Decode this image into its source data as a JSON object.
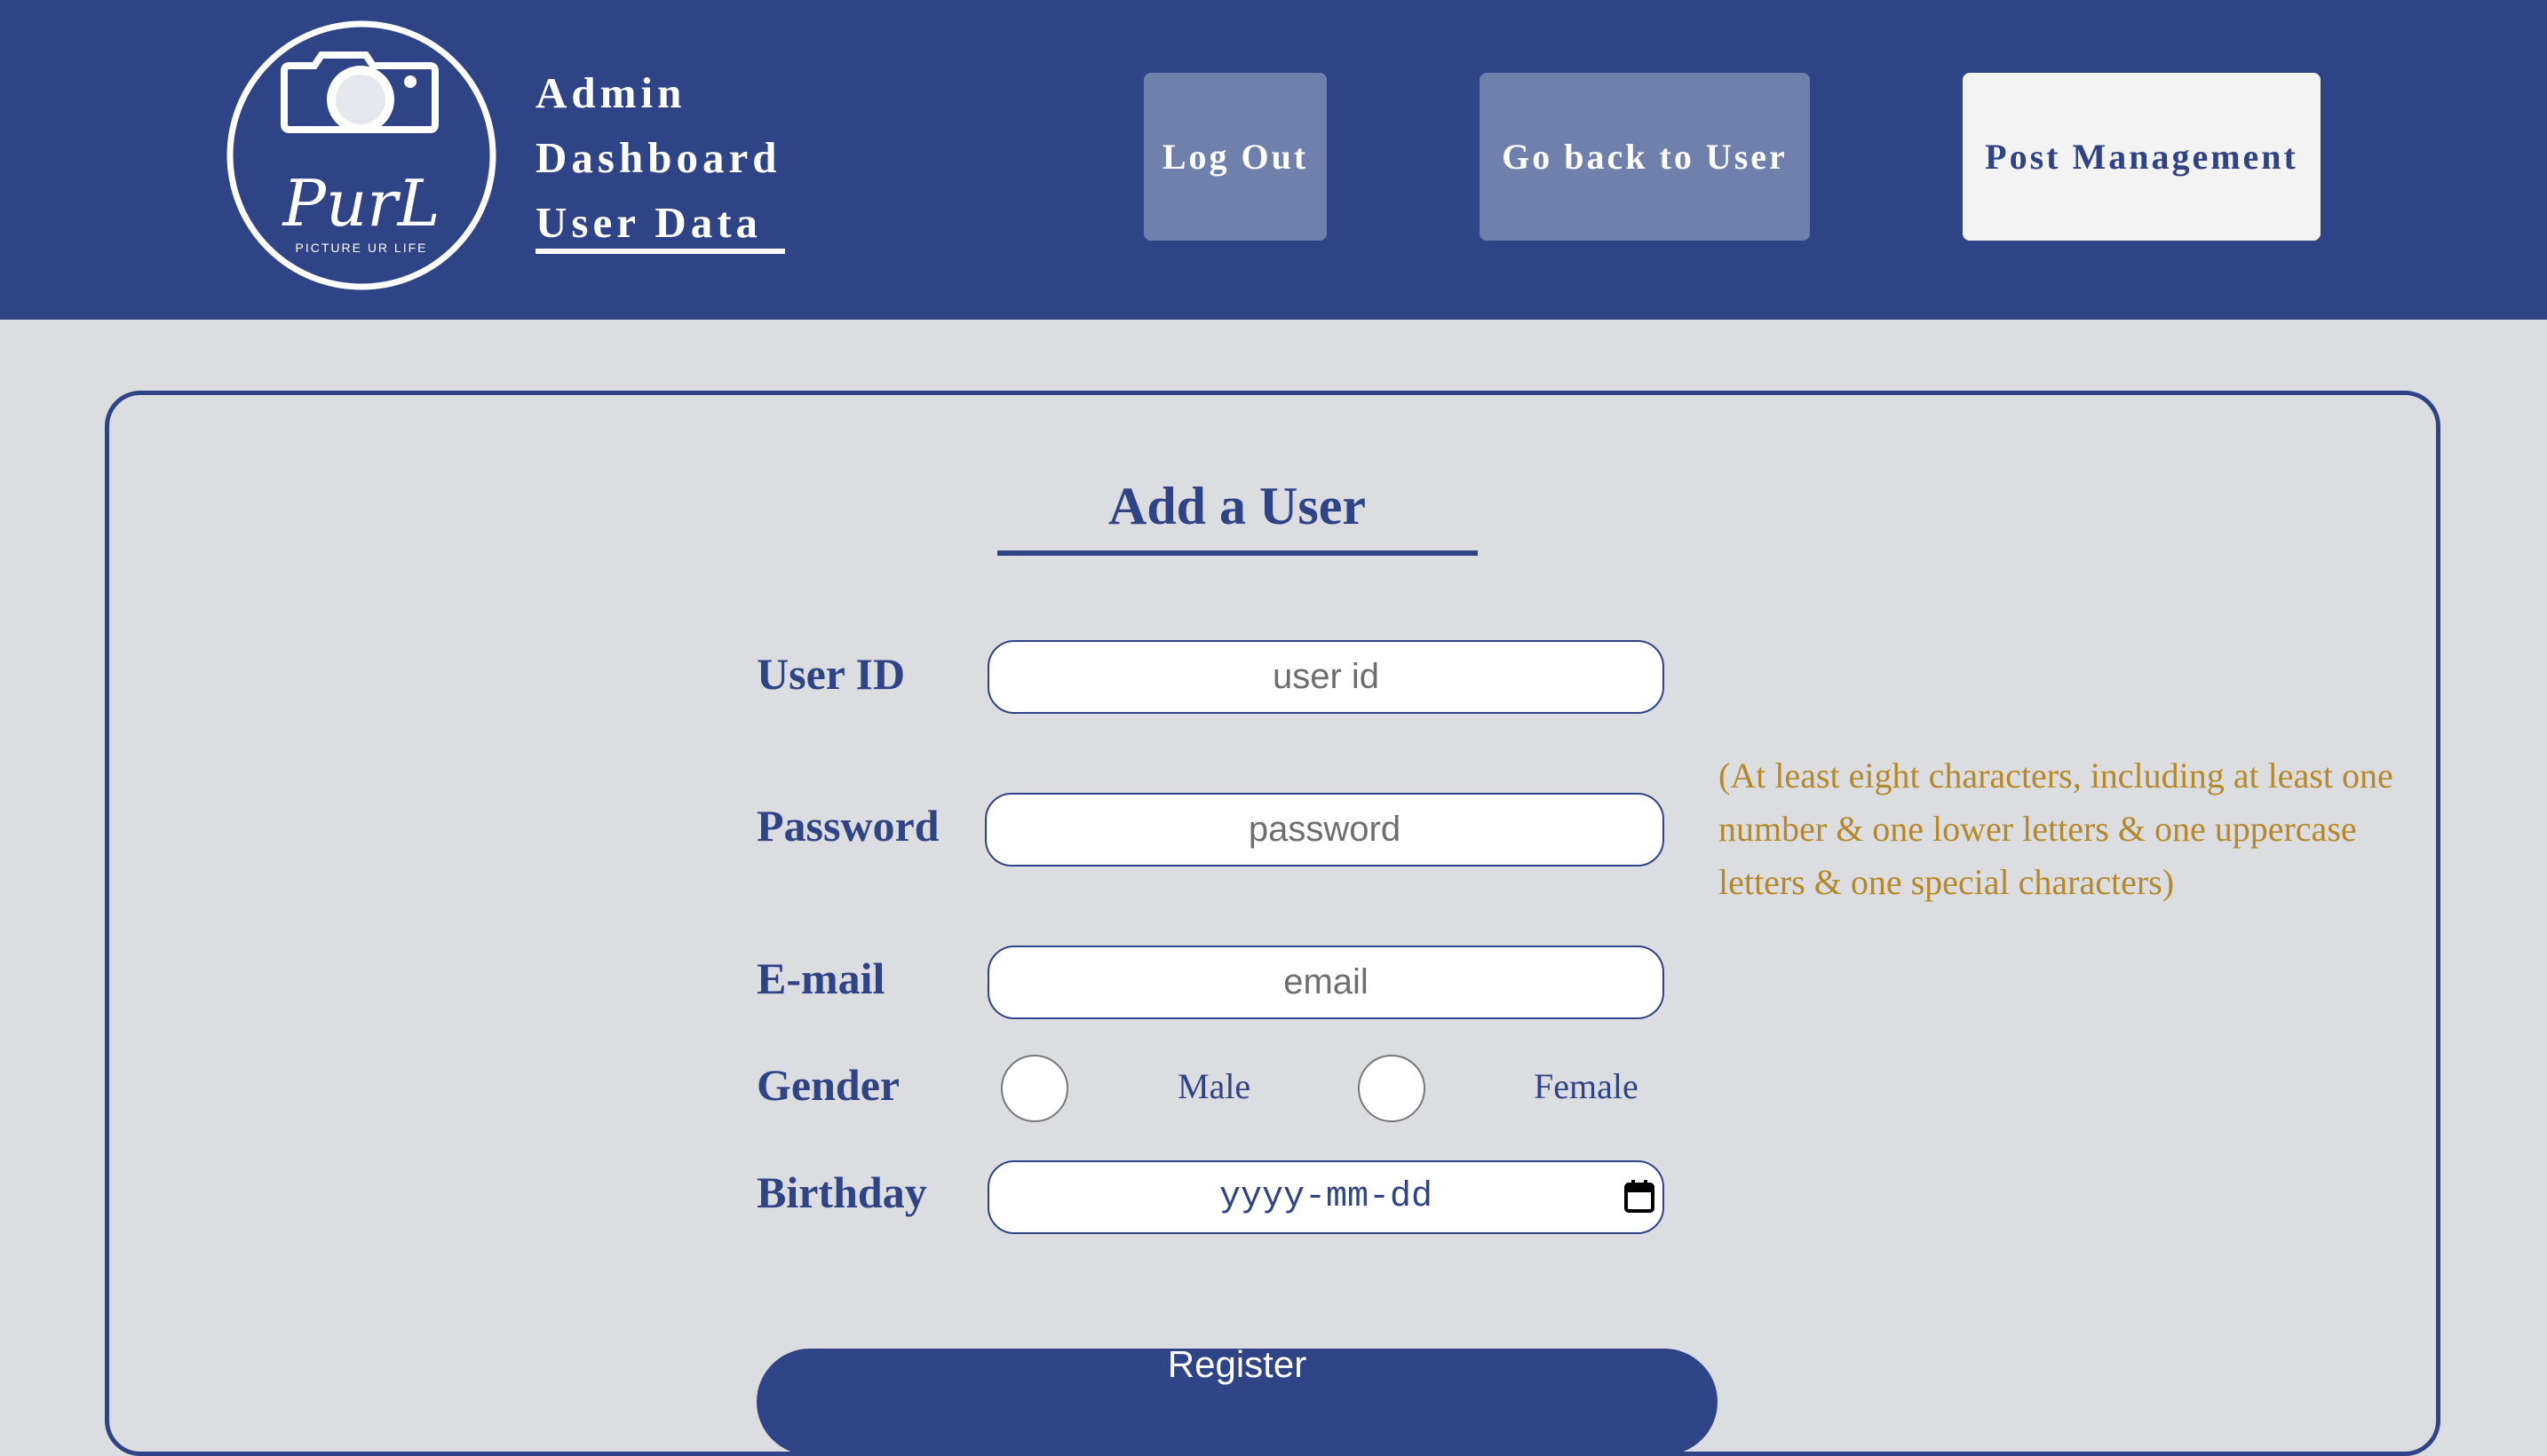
{
  "header": {
    "logo_text": "PurL",
    "logo_tagline": "PICTURE UR LIFE",
    "nav_lines": [
      "Admin",
      "Dashboard",
      "User Data"
    ],
    "buttons": {
      "logout": "Log Out",
      "back_to_user": "Go back to User",
      "post_management": "Post Management"
    }
  },
  "form": {
    "title": "Add a User",
    "user_id": {
      "label": "User ID",
      "placeholder": "user id"
    },
    "password": {
      "label": "Password",
      "placeholder": "password",
      "hint": "(At least eight characters, including at least one number & one lower letters & one uppercase letters & one special characters)"
    },
    "email": {
      "label": "E-mail",
      "placeholder": "email"
    },
    "gender": {
      "label": "Gender",
      "options": [
        "Male",
        "Female"
      ]
    },
    "birthday": {
      "label": "Birthday",
      "placeholder": "yyyy-mm-dd"
    },
    "submit": "Register"
  },
  "colors": {
    "primary": "#2f4387",
    "background": "#dcdde0",
    "muted_button": "#7080ac",
    "light_button": "#f3f3f4",
    "hint": "#b5892a"
  }
}
